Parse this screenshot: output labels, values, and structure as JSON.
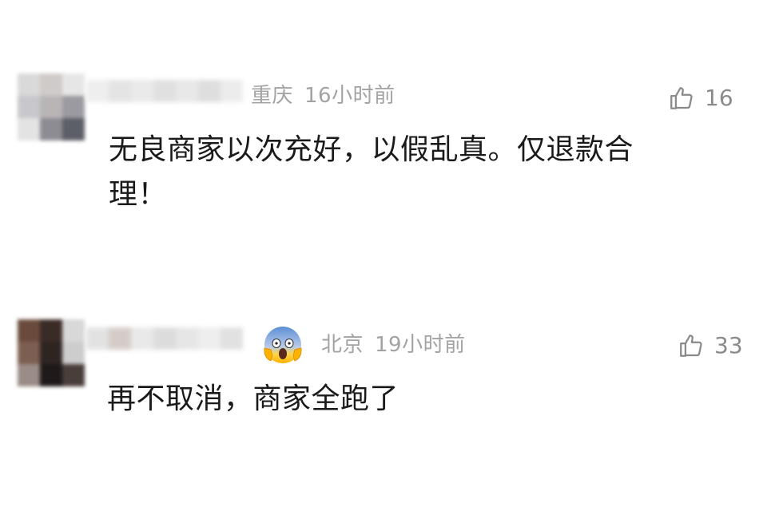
{
  "comments": [
    {
      "location": "重庆",
      "time": "16小时前",
      "likes": "16",
      "text_line1": "无良商家以次充好，以假乱真。仅退款合",
      "text_line2": "理！"
    },
    {
      "location": "北京",
      "time": "19小时前",
      "likes": "33",
      "emoji": "screaming-face-emoji",
      "text": "再不取消，商家全跑了"
    }
  ],
  "icons": {
    "like": "thumbs-up-icon"
  },
  "colors": {
    "meta": "#a3a3a3",
    "text": "#1a1a1a",
    "like": "#8a8a8a"
  }
}
